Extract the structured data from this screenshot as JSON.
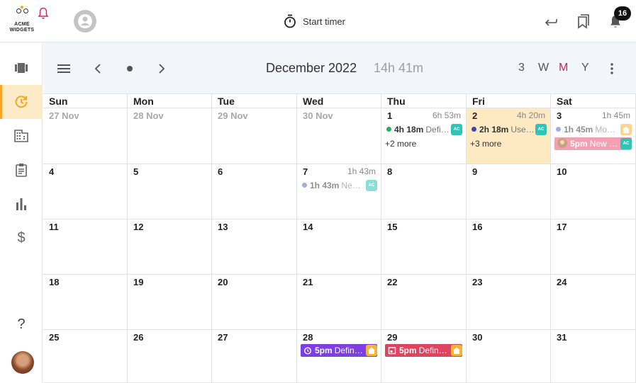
{
  "topbar": {
    "logo_line1": "ACME",
    "logo_line2": "WIDGETS",
    "start_timer_label": "Start timer",
    "notification_count": "16"
  },
  "sidebar": {
    "items": [
      {
        "name": "projects-icon"
      },
      {
        "name": "timer-icon",
        "active": true
      },
      {
        "name": "clients-icon"
      },
      {
        "name": "tasks-icon"
      },
      {
        "name": "reports-icon"
      },
      {
        "name": "billing-icon"
      }
    ],
    "help_label": "?"
  },
  "calendar": {
    "month_label": "December 2022",
    "month_total": "14h 41m",
    "views": [
      "3",
      "W",
      "M",
      "Y"
    ],
    "active_view": "M",
    "weekdays": [
      "Sun",
      "Mon",
      "Tue",
      "Wed",
      "Thu",
      "Fri",
      "Sat"
    ],
    "weeks": [
      [
        "27 Nov",
        "28 Nov",
        "29 Nov",
        "30 Nov",
        "1",
        "2",
        "3"
      ],
      [
        "4",
        "5",
        "6",
        "7",
        "8",
        "9",
        "10"
      ],
      [
        "11",
        "12",
        "13",
        "14",
        "15",
        "16",
        "17"
      ],
      [
        "18",
        "19",
        "20",
        "21",
        "22",
        "23",
        "24"
      ],
      [
        "25",
        "26",
        "27",
        "28",
        "29",
        "30",
        "31"
      ]
    ],
    "day_totals": {
      "thu1": "6h 53m",
      "fri2": "4h 20m",
      "sat3": "1h 45m",
      "wed7": "1h 43m"
    },
    "events": {
      "thu1": {
        "duration": "4h 18m",
        "title": "Defi…",
        "tag": "AC",
        "more": "+2 more"
      },
      "fri2": {
        "duration": "2h 18m",
        "title": "Use…",
        "tag": "AC",
        "more": "+3 more"
      },
      "sat3_a": {
        "duration": "1h 45m",
        "title": "Mo…"
      },
      "sat3_b": {
        "duration": "5pm",
        "title": "New …",
        "tag": "AC"
      },
      "wed7": {
        "duration": "1h 43m",
        "title": "Ne…",
        "tag": "AC"
      },
      "wed28": {
        "duration": "5pm",
        "title": "Defin…"
      },
      "thu29": {
        "duration": "5pm",
        "title": "Defin…"
      }
    }
  },
  "colors": {
    "accent": "#d81b60",
    "active_bg": "#fdebc8",
    "today_bg": "#fde9c2",
    "event_purple": "#7b3fe4",
    "event_red": "#e0435f",
    "event_pink": "#f3a0b5",
    "tag_teal": "#2ec4b6",
    "tag_orange": "#f9b233"
  }
}
